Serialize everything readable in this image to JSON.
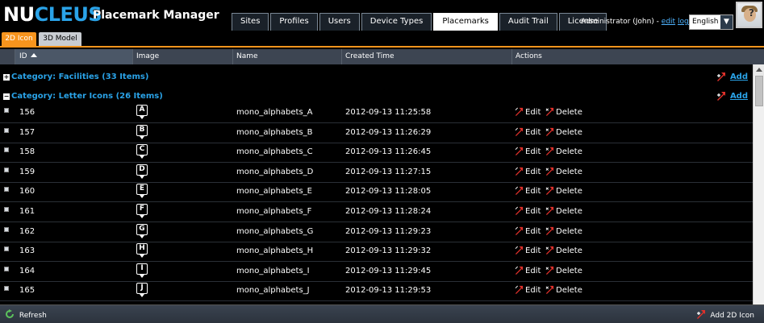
{
  "header": {
    "logo_part1": "NU",
    "logo_part2": "CLEUS",
    "title": "Placemark Manager",
    "tabs": [
      {
        "label": "Sites"
      },
      {
        "label": "Profiles"
      },
      {
        "label": "Users"
      },
      {
        "label": "Device Types"
      },
      {
        "label": "Placemarks",
        "active": true
      },
      {
        "label": "Audit Trail"
      },
      {
        "label": "License"
      }
    ],
    "user_text": "Administrator (John) -",
    "edit_link": "edit",
    "logout_link": "logout",
    "language": "English"
  },
  "subtabs": {
    "icon2d": "2D Icon",
    "model3d": "3D Model"
  },
  "columns": {
    "id": "ID",
    "image": "Image",
    "name": "Name",
    "created": "Created Time",
    "actions": "Actions"
  },
  "categories": {
    "facilities": {
      "label": "Category: Facilities (33 Items)",
      "toggle": "+",
      "add": "Add"
    },
    "letters": {
      "label": "Category: Letter Icons (26 Items)",
      "toggle": "−",
      "add": "Add"
    }
  },
  "rows": [
    {
      "id": "156",
      "letter": "A",
      "name": "mono_alphabets_A",
      "created": "2012-09-13 11:25:58"
    },
    {
      "id": "157",
      "letter": "B",
      "name": "mono_alphabets_B",
      "created": "2012-09-13 11:26:29"
    },
    {
      "id": "158",
      "letter": "C",
      "name": "mono_alphabets_C",
      "created": "2012-09-13 11:26:45"
    },
    {
      "id": "159",
      "letter": "D",
      "name": "mono_alphabets_D",
      "created": "2012-09-13 11:27:15"
    },
    {
      "id": "160",
      "letter": "E",
      "name": "mono_alphabets_E",
      "created": "2012-09-13 11:28:05"
    },
    {
      "id": "161",
      "letter": "F",
      "name": "mono_alphabets_F",
      "created": "2012-09-13 11:28:24"
    },
    {
      "id": "162",
      "letter": "G",
      "name": "mono_alphabets_G",
      "created": "2012-09-13 11:29:23"
    },
    {
      "id": "163",
      "letter": "H",
      "name": "mono_alphabets_H",
      "created": "2012-09-13 11:29:32"
    },
    {
      "id": "164",
      "letter": "I",
      "name": "mono_alphabets_I",
      "created": "2012-09-13 11:29:45"
    },
    {
      "id": "165",
      "letter": "J",
      "name": "mono_alphabets_J",
      "created": "2012-09-13 11:29:53"
    }
  ],
  "actions": {
    "edit": "Edit",
    "delete": "Delete"
  },
  "footer": {
    "refresh": "Refresh",
    "add_2d_icon": "Add 2D Icon"
  },
  "colors": {
    "accent": "#2aa3e8",
    "tab_active": "#f7941d",
    "header_bg": "#3d4552"
  }
}
